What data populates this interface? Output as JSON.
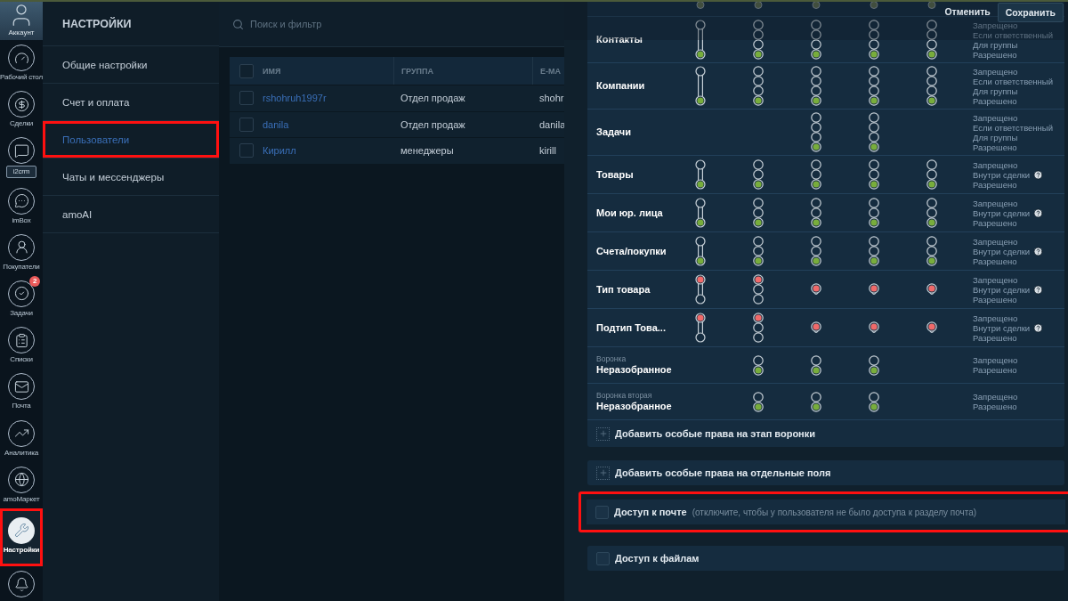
{
  "nav": [
    {
      "kind": "account",
      "label": "Аккаунт",
      "selected": false,
      "highlighted": false
    },
    {
      "kind": "dashboard",
      "label": "Рабочий стол",
      "selected": false,
      "highlighted": false
    },
    {
      "kind": "deals",
      "label": "Сделки",
      "selected": false,
      "highlighted": false
    },
    {
      "kind": "app",
      "label": "i2crm",
      "selected": false,
      "highlighted": false
    },
    {
      "kind": "inbox",
      "label": "imBox",
      "selected": false,
      "highlighted": false
    },
    {
      "kind": "customers",
      "label": "Покупатели",
      "selected": false,
      "highlighted": false
    },
    {
      "kind": "tasks",
      "label": "Задачи",
      "badge": "2",
      "selected": false,
      "highlighted": false
    },
    {
      "kind": "lists",
      "label": "Списки",
      "selected": false,
      "highlighted": false
    },
    {
      "kind": "mail",
      "label": "Почта",
      "selected": false,
      "highlighted": false
    },
    {
      "kind": "analytics",
      "label": "Аналитика",
      "selected": false,
      "highlighted": false
    },
    {
      "kind": "market",
      "label": "amoМаркет",
      "selected": false,
      "highlighted": false
    },
    {
      "kind": "settings",
      "label": "Настройки",
      "selected": true,
      "highlighted": true
    },
    {
      "kind": "notifications",
      "selected": false,
      "highlighted": false
    }
  ],
  "settings": {
    "title": "НАСТРОЙКИ",
    "items": [
      {
        "label": "Общие настройки",
        "selected": false,
        "highlighted": false
      },
      {
        "label": "Счет и оплата",
        "selected": false,
        "highlighted": false
      },
      {
        "label": "Пользователи",
        "selected": true,
        "highlighted": true
      },
      {
        "label": "Чаты и мессенджеры",
        "selected": false,
        "highlighted": false
      },
      {
        "label": "amoAI",
        "selected": false,
        "highlighted": false
      }
    ]
  },
  "users": {
    "search": {
      "placeholder": "Поиск и фильтр"
    },
    "header_checked": false,
    "columns": [
      "ИМЯ",
      "ГРУППА",
      "E-MA"
    ],
    "rows": [
      {
        "checked": false,
        "cells": [
          "rshohruh1997r",
          "Отдел продаж",
          "shohr"
        ]
      },
      {
        "checked": false,
        "cells": [
          "danila",
          "Отдел продаж",
          "danila"
        ]
      },
      {
        "checked": false,
        "cells": [
          "Кирилл",
          "менеджеры",
          "kirill"
        ]
      }
    ]
  },
  "rights": {
    "actions": [
      {
        "kind": "link",
        "label": "Отменить"
      },
      {
        "kind": "primary",
        "label": "Сохранить"
      }
    ],
    "cut_row": [
      {
        "allowed": true
      },
      {
        "allowed": true
      },
      {
        "allowed": true
      },
      {
        "allowed": true
      },
      {
        "allowed": true
      }
    ],
    "rows": [
      {
        "label": "Контакты",
        "options": [
          {
            "text": "Запрещено"
          },
          {
            "text": "Если ответственный"
          },
          {
            "text": "Для группы"
          },
          {
            "text": "Разрешено"
          }
        ],
        "cells": [
          {
            "kind": "straight",
            "allowed": true
          },
          {
            "kind": "stepped",
            "allowed": true
          },
          {
            "kind": "stepped",
            "allowed": true
          },
          {
            "kind": "stepped",
            "allowed": true
          },
          {
            "kind": "stepped",
            "allowed": true
          }
        ]
      },
      {
        "label": "Компании",
        "options": [
          {
            "text": "Запрещено"
          },
          {
            "text": "Если ответственный"
          },
          {
            "text": "Для группы"
          },
          {
            "text": "Разрешено"
          }
        ],
        "cells": [
          {
            "kind": "straight",
            "allowed": true
          },
          {
            "kind": "stepped",
            "allowed": true
          },
          {
            "kind": "stepped",
            "allowed": true
          },
          {
            "kind": "stepped",
            "allowed": true
          },
          {
            "kind": "stepped",
            "allowed": true
          }
        ]
      },
      {
        "label": "Задачи",
        "options": [
          {
            "text": "Запрещено"
          },
          {
            "text": "Если ответственный"
          },
          {
            "text": "Для группы"
          },
          {
            "text": "Разрешено"
          }
        ],
        "cells": [
          {
            "kind": "none"
          },
          {
            "kind": "none"
          },
          {
            "kind": "stepped",
            "allowed": true
          },
          {
            "kind": "stepped",
            "allowed": true
          },
          {
            "kind": "none"
          }
        ]
      },
      {
        "label": "Товары",
        "options": [
          {
            "text": "Запрещено"
          },
          {
            "text": "Внутри сделки",
            "help": true
          },
          {
            "text": "Разрешено"
          }
        ],
        "cells": [
          {
            "kind": "straight",
            "allowed": true
          },
          {
            "kind": "stepped",
            "allowed": true
          },
          {
            "kind": "stepped",
            "allowed": true
          },
          {
            "kind": "stepped",
            "allowed": true
          },
          {
            "kind": "stepped",
            "allowed": true
          }
        ]
      },
      {
        "label": "Мои юр. лица",
        "options": [
          {
            "text": "Запрещено"
          },
          {
            "text": "Внутри сделки",
            "help": true
          },
          {
            "text": "Разрешено"
          }
        ],
        "cells": [
          {
            "kind": "straight",
            "allowed": true
          },
          {
            "kind": "stepped",
            "allowed": true
          },
          {
            "kind": "stepped",
            "allowed": true
          },
          {
            "kind": "stepped",
            "allowed": true
          },
          {
            "kind": "stepped",
            "allowed": true
          }
        ]
      },
      {
        "label": "Счета/покупки",
        "options": [
          {
            "text": "Запрещено"
          },
          {
            "text": "Внутри сделки",
            "help": true
          },
          {
            "text": "Разрешено"
          }
        ],
        "cells": [
          {
            "kind": "straight",
            "allowed": true
          },
          {
            "kind": "stepped",
            "allowed": true
          },
          {
            "kind": "stepped",
            "allowed": true
          },
          {
            "kind": "stepped",
            "allowed": true
          },
          {
            "kind": "stepped",
            "allowed": true
          }
        ]
      },
      {
        "label": "Тип товара",
        "options": [
          {
            "text": "Запрещено"
          },
          {
            "text": "Внутри сделки",
            "help": true
          },
          {
            "text": "Разрешено"
          }
        ],
        "cells": [
          {
            "kind": "straight",
            "allowed": false
          },
          {
            "kind": "stepped",
            "allowed": false
          },
          {
            "kind": "single",
            "allowed": false
          },
          {
            "kind": "single",
            "allowed": false
          },
          {
            "kind": "single",
            "allowed": false
          }
        ]
      },
      {
        "label": "Подтип Това...",
        "options": [
          {
            "text": "Запрещено"
          },
          {
            "text": "Внутри сделки",
            "help": true
          },
          {
            "text": "Разрешено"
          }
        ],
        "cells": [
          {
            "kind": "straight",
            "allowed": false
          },
          {
            "kind": "stepped",
            "allowed": false
          },
          {
            "kind": "single",
            "allowed": false
          },
          {
            "kind": "single",
            "allowed": false
          },
          {
            "kind": "single",
            "allowed": false
          }
        ]
      },
      {
        "sublabel": "Воронка",
        "label": "Неразобранное",
        "options": [
          {
            "text": "Запрещено"
          },
          {
            "text": "Разрешено"
          }
        ],
        "cells": [
          {
            "kind": "none"
          },
          {
            "kind": "stepped",
            "allowed": true
          },
          {
            "kind": "stepped",
            "allowed": true
          },
          {
            "kind": "stepped",
            "allowed": true
          },
          {
            "kind": "none"
          }
        ]
      },
      {
        "sublabel": "Воронка вторая",
        "label": "Неразобранное",
        "options": [
          {
            "text": "Запрещено"
          },
          {
            "text": "Разрешено"
          }
        ],
        "cells": [
          {
            "kind": "none"
          },
          {
            "kind": "stepped",
            "allowed": true
          },
          {
            "kind": "stepped",
            "allowed": true
          },
          {
            "kind": "stepped",
            "allowed": true
          },
          {
            "kind": "none"
          }
        ]
      }
    ],
    "add_stage": "Добавить особые права на этап воронки"
  },
  "extras": [
    {
      "kind": "add",
      "label": "Добавить особые права на отдельные поля",
      "highlighted": false
    },
    {
      "kind": "check",
      "label": "Доступ к почте",
      "note": "(отключите, чтобы у пользователя не было доступа к разделу почта)",
      "checked": false,
      "highlighted": true
    },
    {
      "kind": "check",
      "label": "Доступ к файлам",
      "checked": false,
      "highlighted": false
    }
  ]
}
